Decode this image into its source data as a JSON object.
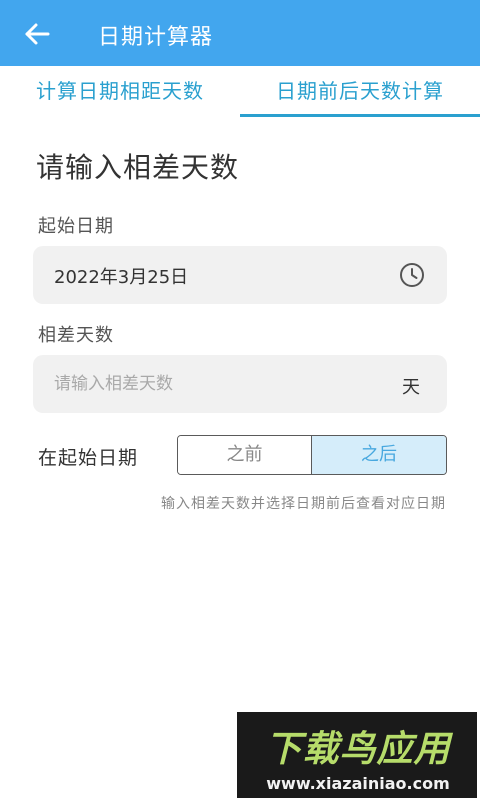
{
  "appbar": {
    "title": "日期计算器",
    "back_icon": "arrow-left-icon"
  },
  "tabs": [
    {
      "label": "计算日期相距天数",
      "active": false
    },
    {
      "label": "日期前后天数计算",
      "active": true
    }
  ],
  "form": {
    "heading": "请输入相差天数",
    "start_label": "起始日期",
    "start_value": "2022年3月25日",
    "start_icon": "clock-icon",
    "diff_label": "相差天数",
    "diff_value": "",
    "diff_placeholder": "请输入相差天数",
    "diff_unit": "天",
    "direction_label": "在起始日期",
    "direction_options": [
      "之前",
      "之后"
    ],
    "direction_selected": "之后",
    "hint": "输入相差天数并选择日期前后查看对应日期"
  },
  "watermark": {
    "brand": "下载鸟应用",
    "url": "www.xiazainiao.com"
  },
  "colors": {
    "appbar": "#42a6ee",
    "tab_accent": "#2aa0cf",
    "field_bg": "#f1f1f1",
    "selected_bg": "#d5edfa",
    "selected_text": "#48a8df",
    "watermark_green": "#b6dc6a"
  }
}
